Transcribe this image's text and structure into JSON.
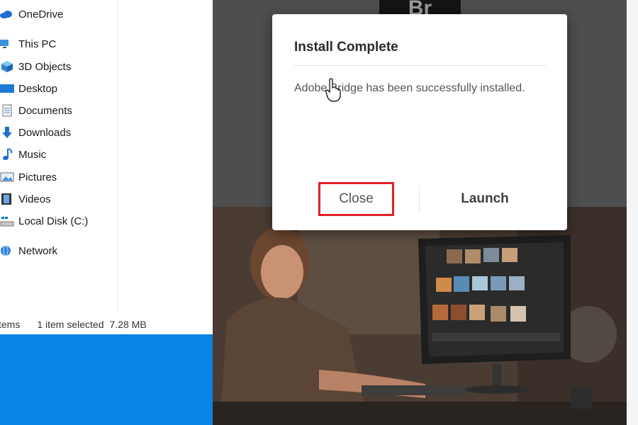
{
  "explorer": {
    "nav_items": [
      {
        "label": "OneDrive",
        "icon": "cloud-icon"
      },
      {
        "label": "This PC",
        "icon": "computer-icon"
      },
      {
        "label": "3D Objects",
        "icon": "cube-icon"
      },
      {
        "label": "Desktop",
        "icon": "desktop-icon"
      },
      {
        "label": "Documents",
        "icon": "document-icon"
      },
      {
        "label": "Downloads",
        "icon": "download-arrow-icon"
      },
      {
        "label": "Music",
        "icon": "music-note-icon"
      },
      {
        "label": "Pictures",
        "icon": "picture-icon"
      },
      {
        "label": "Videos",
        "icon": "film-icon"
      },
      {
        "label": "Local Disk (C:)",
        "icon": "drive-icon"
      },
      {
        "label": "Network",
        "icon": "network-icon"
      }
    ],
    "status": {
      "items_text": "tems",
      "selected_text": "1 item selected",
      "size_text": "7.28 MB"
    }
  },
  "installer": {
    "logo_text": "Br",
    "dialog": {
      "title": "Install Complete",
      "message": "Adobe Bridge has been successfully installed.",
      "close_label": "Close",
      "launch_label": "Launch"
    }
  },
  "colors": {
    "highlight_border": "#e31f26",
    "taskbar_blue": "#0a84e6"
  }
}
